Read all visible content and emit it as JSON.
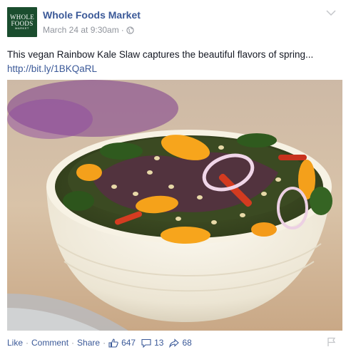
{
  "post": {
    "page_name": "Whole Foods Market",
    "logo": {
      "line1": "WHOLE",
      "line2": "FOODS",
      "line3": "MARKET"
    },
    "date": "March 24 at 9:30am",
    "separator": "·",
    "privacy_icon": "globe-icon",
    "options_icon": "chevron-down-icon",
    "caption": "This vegan Rainbow Kale Slaw captures the beautiful flavors of spring...",
    "link": "http://bit.ly/1BKQaRL",
    "image_subject": "bowl of rainbow kale slaw"
  },
  "footer": {
    "like_label": "Like",
    "comment_label": "Comment",
    "share_label": "Share",
    "separator": "·",
    "likes_count": "647",
    "comments_count": "13",
    "shares_count": "68",
    "like_icon": "thumbs-up-icon",
    "comment_icon": "comment-bubble-icon",
    "share_icon": "share-arrow-icon",
    "flag_icon": "flag-icon"
  },
  "colors": {
    "link_blue": "#3b5998",
    "meta_gray": "#90949c",
    "logo_green": "#1a4d2e"
  }
}
